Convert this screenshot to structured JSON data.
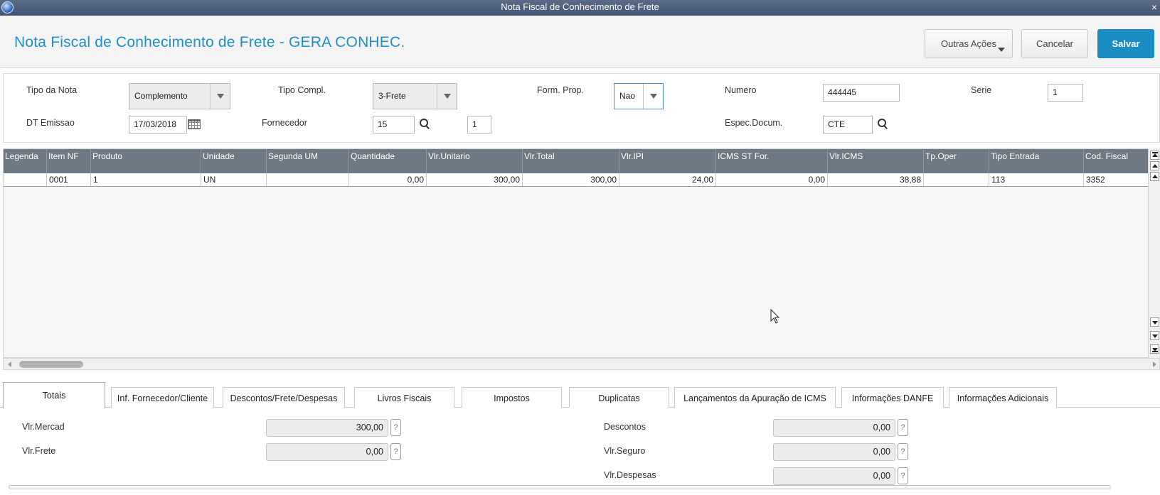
{
  "window": {
    "title": "Nota Fiscal de Conhecimento de Frete",
    "close": "×"
  },
  "header": {
    "title": "Nota Fiscal de Conhecimento de Frete - GERA CONHEC.",
    "outras_acoes": "Outras Ações",
    "cancelar": "Cancelar",
    "salvar": "Salvar"
  },
  "form": {
    "tipo_nota_label": "Tipo da Nota",
    "tipo_nota_value": "Complemento",
    "tipo_compl_label": "Tipo Compl.",
    "tipo_compl_value": "3-Frete",
    "form_prop_label": "Form. Prop.",
    "form_prop_value": "Nao",
    "numero_label": "Numero",
    "numero_value": "444445",
    "serie_label": "Serie",
    "serie_value": "1",
    "dt_emissao_label": "DT Emissao",
    "dt_emissao_value": "17/03/2018",
    "fornecedor_label": "Fornecedor",
    "fornecedor_value": "15",
    "loja_value": "1",
    "espec_label": "Espec.Docum.",
    "espec_value": "CTE"
  },
  "grid": {
    "columns": [
      "Legenda",
      "Item NF",
      "Produto",
      "Unidade",
      "Segunda UM",
      "Quantidade",
      "Vlr.Unitario",
      "Vlr.Total",
      "Vlr.IPI",
      "ICMS ST For.",
      "Vlr.ICMS",
      "Tp.Oper",
      "Tipo Entrada",
      "Cod. Fiscal"
    ],
    "rows": [
      [
        "",
        "0001",
        "1",
        "UN",
        "",
        "0,00",
        "300,00",
        "300,00",
        "24,00",
        "0,00",
        "38,88",
        "",
        "113",
        "3352"
      ]
    ]
  },
  "tabs": [
    "Totais",
    "Inf. Fornecedor/Cliente",
    "Descontos/Frete/Despesas",
    "Livros Fiscais",
    "Impostos",
    "Duplicatas",
    "Lançamentos da Apuração de ICMS",
    "Informações DANFE",
    "Informações Adicionais"
  ],
  "totals": {
    "vlr_mercad_label": "Vlr.Mercad",
    "vlr_mercad_value": "300,00",
    "vlr_frete_label": "Vlr.Frete",
    "vlr_frete_value": "0,00",
    "descontos_label": "Descontos",
    "descontos_value": "0,00",
    "vlr_seguro_label": "Vlr.Seguro",
    "vlr_seguro_value": "0,00",
    "vlr_despesas_label": "Vlr.Despesas",
    "vlr_despesas_value": "0,00",
    "help": "?"
  }
}
